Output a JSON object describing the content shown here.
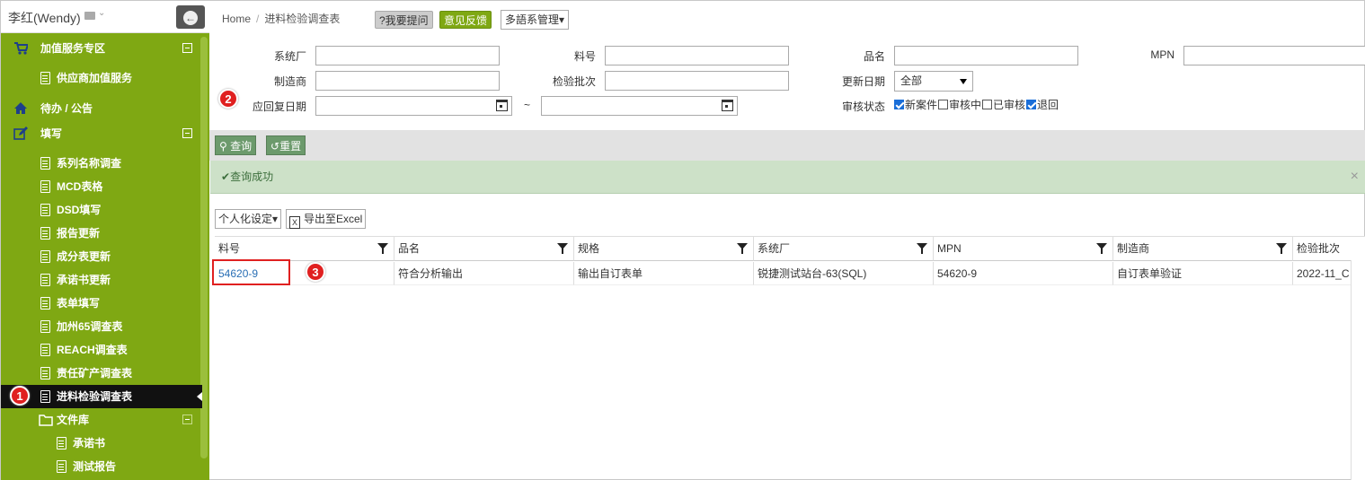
{
  "user": {
    "name": "李红(Wendy)"
  },
  "sidebar": {
    "items": [
      {
        "label": "加值服务专区",
        "level": 0,
        "icon": "cart-icon",
        "collapsible": true
      },
      {
        "label": "供应商加值服务",
        "level": 1,
        "icon": "document-icon"
      },
      {
        "label": "待办 / 公告",
        "level": 0,
        "icon": "home-icon"
      },
      {
        "label": "填写",
        "level": 0,
        "icon": "edit-icon",
        "collapsible": true
      },
      {
        "label": "系列名称调查",
        "level": 1,
        "icon": "document-icon"
      },
      {
        "label": "MCD表格",
        "level": 1,
        "icon": "document-icon"
      },
      {
        "label": "DSD填写",
        "level": 1,
        "icon": "document-icon"
      },
      {
        "label": "报告更新",
        "level": 1,
        "icon": "document-icon"
      },
      {
        "label": "成分表更新",
        "level": 1,
        "icon": "document-icon"
      },
      {
        "label": "承诺书更新",
        "level": 1,
        "icon": "document-icon"
      },
      {
        "label": "表单填写",
        "level": 1,
        "icon": "document-icon"
      },
      {
        "label": "加州65调查表",
        "level": 1,
        "icon": "document-icon"
      },
      {
        "label": "REACH调查表",
        "level": 1,
        "icon": "document-icon"
      },
      {
        "label": "责任矿产调查表",
        "level": 1,
        "icon": "document-icon"
      },
      {
        "label": "进料检验调查表",
        "level": 1,
        "icon": "document-icon",
        "active": true
      },
      {
        "label": "文件库",
        "level": 1,
        "icon": "folder-icon",
        "collapsible": true
      },
      {
        "label": "承诺书",
        "level": 2,
        "icon": "document-icon"
      },
      {
        "label": "测试报告",
        "level": 2,
        "icon": "document-icon"
      }
    ]
  },
  "badges": {
    "one": "1",
    "two": "2",
    "three": "3"
  },
  "header": {
    "home": "Home",
    "sep": "/",
    "page": "进料检验调查表",
    "ask": "?我要提问",
    "feedback": "意见反馈",
    "lang": "多語系管理"
  },
  "filters": {
    "factory": "系统厂",
    "part_no": "料号",
    "product_name": "品名",
    "mpn": "MPN",
    "maker": "制造商",
    "batch": "检验批次",
    "update_date": "更新日期",
    "update_date_value": "全部",
    "reply_date": "应回复日期",
    "tilde": "~",
    "review_status": "审核状态",
    "status_new": "新案件",
    "status_reviewing": "审核中",
    "status_reviewed": "已审核",
    "status_returned": "退回"
  },
  "toolbar": {
    "search": "查询",
    "reset": "重置"
  },
  "message": {
    "text": "查询成功",
    "close": "×"
  },
  "grid_tools": {
    "personalize": "个人化设定",
    "export": "导出至Excel"
  },
  "table": {
    "columns": [
      "料号",
      "品名",
      "规格",
      "系统厂",
      "MPN",
      "制造商",
      "检验批次"
    ],
    "rows": [
      [
        "54620-9",
        "符合分析输出",
        "输出自订表单",
        "锐捷测试站台-63(SQL)",
        "54620-9",
        "自订表单验证",
        "2022-11_C"
      ]
    ]
  }
}
